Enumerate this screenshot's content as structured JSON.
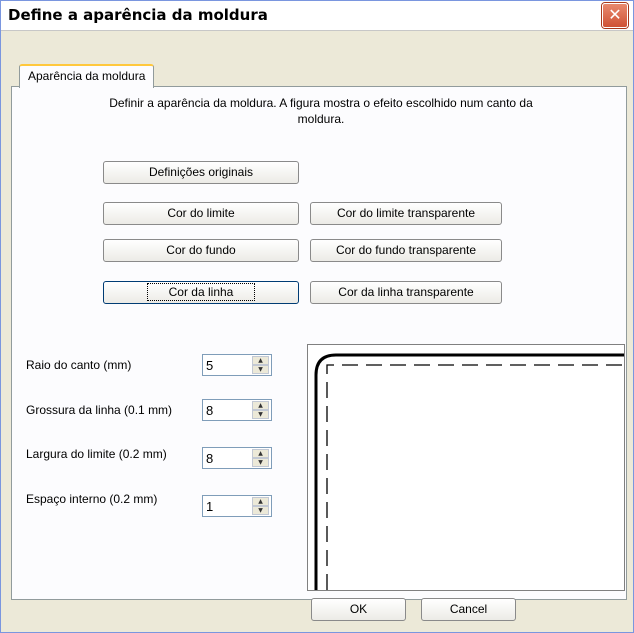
{
  "window": {
    "title": "Define a aparência da moldura",
    "close_glyph": "✕"
  },
  "tabs": [
    {
      "label": "Aparência da moldura",
      "selected": true
    }
  ],
  "description": "Definir a aparência da moldura. A figura mostra o efeito escolhido num canto da moldura.",
  "buttons": {
    "original_settings": "Definições originais",
    "border_color": "Cor do limite",
    "border_color_transparent": "Cor do limite transparente",
    "background_color": "Cor do fundo",
    "background_color_transparent": "Cor do fundo transparente",
    "line_color": "Cor da linha",
    "line_color_transparent": "Cor da linha transparente",
    "ok": "OK",
    "cancel": "Cancel"
  },
  "fields": [
    {
      "label": "Raio do canto (mm)",
      "value": "5"
    },
    {
      "label": "Grossura da linha (0.1 mm)",
      "value": "8"
    },
    {
      "label": "Largura do limite (0.2 mm)",
      "value": "8"
    },
    {
      "label": "Espaço interno (0.2 mm)",
      "value": "1"
    }
  ],
  "icons": {
    "spin_up": "▲",
    "spin_down": "▼"
  },
  "colors": {
    "dialog_bg": "#ece9d8",
    "close_button": "#cf5235",
    "tab_highlight": "#ffc83c"
  }
}
